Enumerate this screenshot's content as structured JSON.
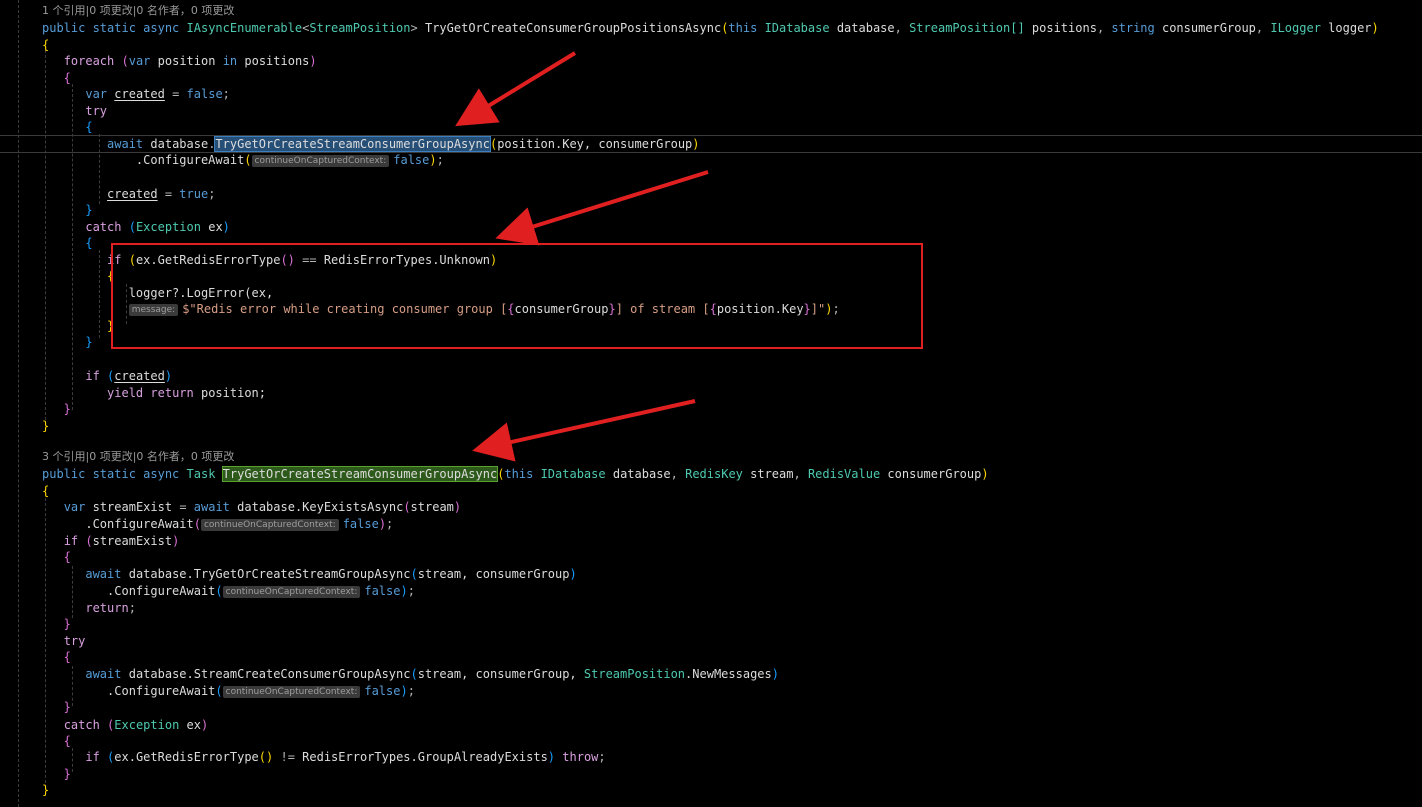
{
  "code_lens": {
    "first": "1 个引用|0 项更改|0 名作者，0 项更改",
    "second": "3 个引用|0 项更改|0 名作者，0 项更改"
  },
  "method1": {
    "modifiers": "public static async",
    "return_type_outer": "IAsyncEnumerable",
    "return_type_inner": "StreamPosition",
    "name": "TryGetOrCreateConsumerGroupPositionsAsync",
    "params": [
      {
        "mod": "this",
        "type": "IDatabase",
        "name": "database"
      },
      {
        "type": "StreamPosition[]",
        "name": "positions"
      },
      {
        "type": "string",
        "name": "consumerGroup"
      },
      {
        "type": "ILogger",
        "name": "logger"
      }
    ],
    "foreach_kw": "foreach",
    "foreach_var": "var",
    "foreach_item": "position",
    "foreach_in": "in",
    "foreach_coll": "positions",
    "created_decl_kw": "var",
    "created_var": "created",
    "created_init": "false",
    "try_kw": "try",
    "await_kw": "await",
    "database": "database",
    "call_highlighted": "TryGetOrCreateStreamConsumerGroupAsync",
    "call_args": "position.Key, consumerGroup",
    "configure_await": ".ConfigureAwait",
    "hint_label": "continueOnCapturedContext:",
    "false_kw": "false",
    "created_set_true": "true",
    "catch_kw": "catch",
    "exception_type": "Exception",
    "exception_var": "ex",
    "if_kw": "if",
    "if_cond_left": "ex.GetRedisErrorType",
    "if_cond_op": "==",
    "if_cond_right": "RedisErrorTypes.Unknown",
    "log_call": "logger?.LogError(ex,",
    "message_hint": "message:",
    "message_prefix": "$\"Redis error while creating consumer group [",
    "message_arg1": "consumerGroup",
    "message_mid": "] of stream [",
    "message_arg2": "position.Key",
    "message_suffix": "]\"",
    "if_created_kw": "if",
    "yield_kw": "yield",
    "return_kw": "return",
    "yield_value": "position;"
  },
  "method2": {
    "modifiers": "public static async",
    "return_type": "Task",
    "name": "TryGetOrCreateStreamConsumerGroupAsync",
    "params": [
      {
        "mod": "this",
        "type": "IDatabase",
        "name": "database"
      },
      {
        "type": "RedisKey",
        "name": "stream"
      },
      {
        "type": "RedisValue",
        "name": "consumerGroup"
      }
    ],
    "var_kw": "var",
    "stream_exist": "streamExist",
    "await_kw": "await",
    "key_exists_call": "database.KeyExistsAsync",
    "stream_arg": "stream",
    "configure_await": ".ConfigureAwait",
    "hint_label": "continueOnCapturedContext:",
    "false_kw": "false",
    "if_kw": "if",
    "group_call": "database.TryGetOrCreateStreamGroupAsync",
    "group_args": "stream, consumerGroup",
    "return_kw": "return",
    "try_kw": "try",
    "create_call": "database.StreamCreateConsumerGroupAsync",
    "create_args_a": "stream, consumerGroup, ",
    "create_args_type": "StreamPosition",
    "create_args_b": ".NewMessages",
    "catch_kw": "catch",
    "exception_type": "Exception",
    "exception_var": "ex",
    "cond_left": "ex.GetRedisErrorType",
    "cond_op": "!=",
    "cond_right": "RedisErrorTypes.GroupAlreadyExists",
    "throw_kw": "throw"
  },
  "colors": {
    "background": "#000000",
    "keyword": "#569cd6",
    "type": "#4ec9b0",
    "control": "#d8a0df",
    "string": "#d69d85",
    "annotation_red": "#e02020"
  }
}
